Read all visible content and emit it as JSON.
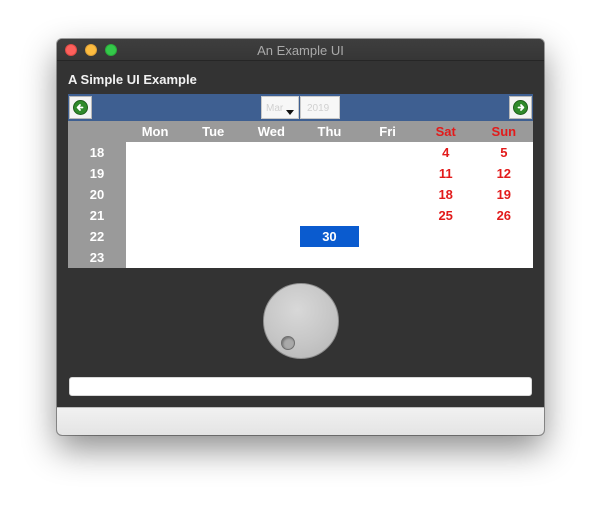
{
  "window": {
    "title": "An Example UI"
  },
  "heading": "A Simple UI Example",
  "calendar": {
    "month": "Mar",
    "year": "2019",
    "weekdays": [
      "Mon",
      "Tue",
      "Wed",
      "Thu",
      "Fri",
      "Sat",
      "Sun"
    ],
    "weeks": [
      "18",
      "19",
      "20",
      "21",
      "22",
      "23"
    ],
    "rows": [
      [
        "",
        "",
        "",
        "",
        "",
        "4",
        "5"
      ],
      [
        "",
        "",
        "",
        "",
        "",
        "11",
        "12"
      ],
      [
        "",
        "",
        "",
        "",
        "",
        "18",
        "19"
      ],
      [
        "",
        "",
        "",
        "",
        "",
        "25",
        "26"
      ],
      [
        "",
        "",
        "",
        "30",
        "",
        "",
        ""
      ],
      [
        "",
        "",
        "",
        "",
        "",
        "",
        ""
      ]
    ],
    "selected_day": "30"
  },
  "dial": {
    "value": 0.0
  },
  "text_field": {
    "value": ""
  },
  "colors": {
    "nav_bar": "#3e5f91",
    "weekend": "#e21b1b",
    "selection": "#0a5bcf",
    "background": "#333333"
  },
  "icons": {
    "prev": "arrow-left-circle-icon",
    "next": "arrow-right-circle-icon"
  }
}
